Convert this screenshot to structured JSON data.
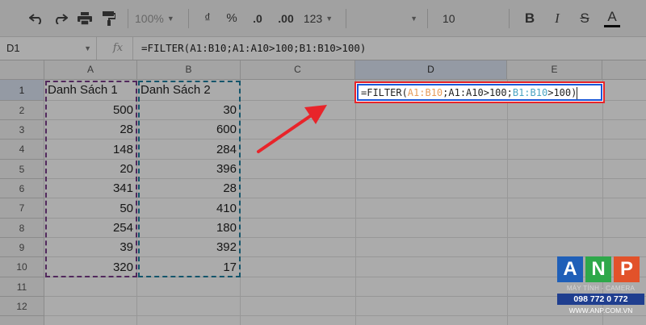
{
  "toolbar": {
    "zoom": "100%",
    "currency": "₫",
    "percent": "%",
    "dec_decrease": ".0",
    "dec_increase": ".00",
    "format_more": "123",
    "font_size": "10",
    "bold": "B",
    "italic": "I",
    "strike": "S",
    "text_color": "A"
  },
  "formula_bar": {
    "cell_ref": "D1",
    "fx": "fx",
    "formula": "=FILTER(A1:B10;A1:A10>100;B1:B10>100)"
  },
  "columns": [
    "A",
    "B",
    "C",
    "D",
    "E"
  ],
  "rows": [
    "1",
    "2",
    "3",
    "4",
    "5",
    "6",
    "7",
    "8",
    "9",
    "10",
    "11",
    "12"
  ],
  "sheet": {
    "a1": "Danh Sách 1",
    "b1": "Danh Sách 2",
    "list1": [
      "500",
      "28",
      "148",
      "20",
      "341",
      "50",
      "254",
      "39",
      "320"
    ],
    "list2": [
      "30",
      "600",
      "284",
      "396",
      "28",
      "410",
      "180",
      "392",
      "17"
    ]
  },
  "editor": {
    "eq": "=FILTER(",
    "r1": "A1:B10",
    "s1": ";A1:A10>100;",
    "r2": "B1:B10",
    "s2": ">100)"
  },
  "logo": {
    "letters": [
      "A",
      "N",
      "P"
    ],
    "tagline": "MÁY TÍNH - CAMERA",
    "phone": "098 772 0 772",
    "website": "WWW.ANP.COM.VN",
    "colors": [
      "#1f5fb8",
      "#2ea84a",
      "#e2522a"
    ]
  },
  "colors": {
    "highlight_red": "#e8242a",
    "selection_blue": "#1a58d8",
    "range1": "#e69b5a",
    "range2": "#4aa3c2",
    "arrow": "#e8242a"
  }
}
